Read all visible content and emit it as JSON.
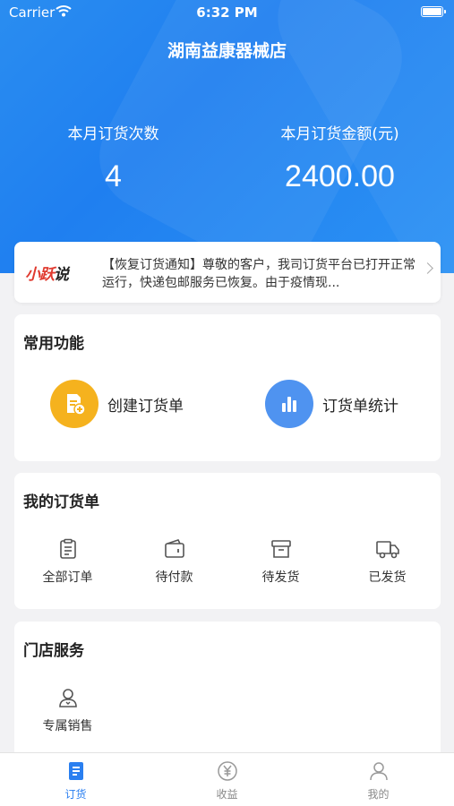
{
  "status_bar": {
    "carrier": "Carrier",
    "time": "6:32 PM"
  },
  "header": {
    "store_name": "湖南益康器械店",
    "stats": [
      {
        "label": "本月订货次数",
        "value": "4"
      },
      {
        "label": "本月订货金额(元)",
        "value": "2400.00"
      }
    ]
  },
  "notice": {
    "logo": {
      "part1": "小跃",
      "part2": "说"
    },
    "text": "【恢复订货通知】尊敬的客户，我司订货平台已打开正常运行，快递包邮服务已恢复。由于疫情现..."
  },
  "functions": {
    "title": "常用功能",
    "items": [
      {
        "label": "创建订货单",
        "icon": "document-add-icon",
        "color": "#f5b21e"
      },
      {
        "label": "订货单统计",
        "icon": "bar-chart-icon",
        "color": "#4f93f0"
      }
    ]
  },
  "orders": {
    "title": "我的订货单",
    "items": [
      {
        "label": "全部订单",
        "icon": "clipboard-icon"
      },
      {
        "label": "待付款",
        "icon": "wallet-icon"
      },
      {
        "label": "待发货",
        "icon": "box-icon"
      },
      {
        "label": "已发货",
        "icon": "truck-icon"
      }
    ]
  },
  "services": {
    "title": "门店服务",
    "items": [
      {
        "label": "专属销售",
        "icon": "sales-person-icon"
      }
    ]
  },
  "tabbar": {
    "tabs": [
      {
        "label": "订货",
        "icon": "order-doc-icon",
        "active": true
      },
      {
        "label": "收益",
        "icon": "yen-coin-icon",
        "active": false
      },
      {
        "label": "我的",
        "icon": "user-icon",
        "active": false
      }
    ],
    "active_color": "#2a7ff0"
  }
}
